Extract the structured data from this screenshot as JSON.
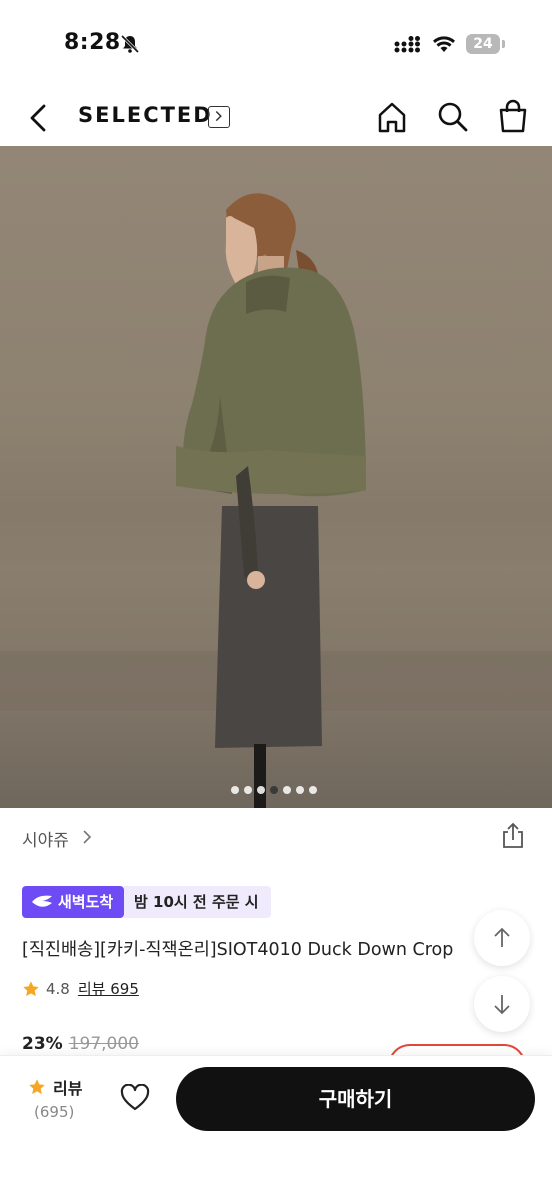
{
  "status_bar": {
    "time": "8:28",
    "battery": "24"
  },
  "header": {
    "brand": "SELECTED",
    "icons": [
      "back-icon",
      "home-icon",
      "search-icon",
      "cart-icon"
    ]
  },
  "gallery": {
    "total_images": 7,
    "active_index": 3
  },
  "product": {
    "seller": "시야쥬",
    "delivery_badge": "새벽도착",
    "delivery_note": "밤 10시 전 주문 시",
    "title": "[직진배송][카키-직잭온리]SIOT4010 Duck Down Crop",
    "rating": "4.8",
    "review_link": "리뷰 695",
    "discount": "23%",
    "original_price": "197,000"
  },
  "bottom_bar": {
    "review_label": "리뷰",
    "review_count": "(695)",
    "buy_label": "구매하기"
  },
  "colors": {
    "accent_purple": "#6e4bf5",
    "buy_button": "#111111",
    "star": "#f5a623"
  }
}
